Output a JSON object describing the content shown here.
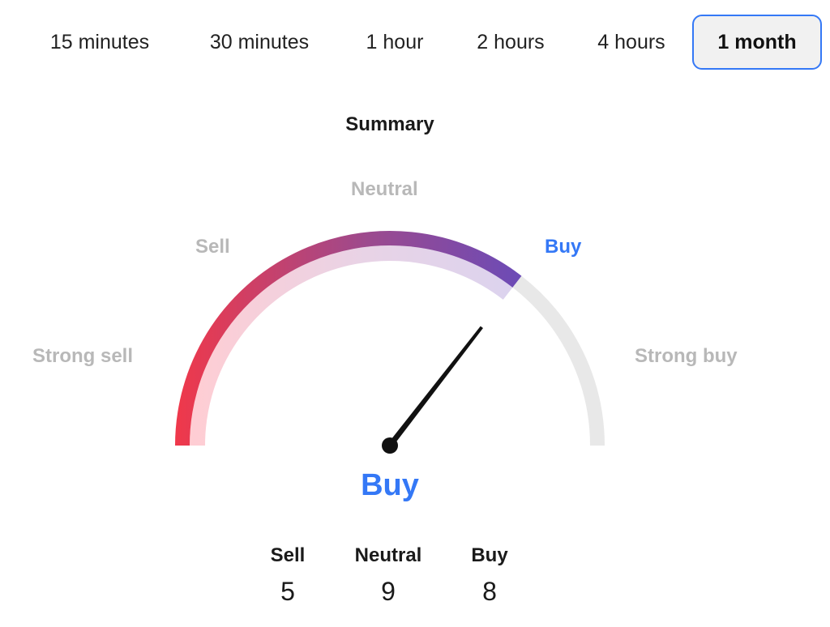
{
  "timeframes": [
    {
      "label": "15 minutes",
      "active": false
    },
    {
      "label": "30 minutes",
      "active": false
    },
    {
      "label": "1 hour",
      "active": false
    },
    {
      "label": "2 hours",
      "active": false
    },
    {
      "label": "4 hours",
      "active": false
    },
    {
      "label": "1 month",
      "active": true
    }
  ],
  "summary": {
    "title": "Summary",
    "gauge_labels": {
      "strong_sell": "Strong sell",
      "sell": "Sell",
      "neutral": "Neutral",
      "buy": "Buy",
      "strong_buy": "Strong buy"
    },
    "active_label": "buy",
    "gauge_fraction": 0.71,
    "verdict": "Buy",
    "counts": [
      {
        "label": "Sell",
        "value": "5"
      },
      {
        "label": "Neutral",
        "value": "9"
      },
      {
        "label": "Buy",
        "value": "8"
      }
    ]
  },
  "colors": {
    "accent": "#3478f6",
    "gauge_start": "#f0384a",
    "gauge_mid": "#9c4a8e",
    "gauge_end": "#6a4bb8",
    "gauge_track": "#e8e8e8",
    "label_inactive": "#b8b8b8"
  }
}
